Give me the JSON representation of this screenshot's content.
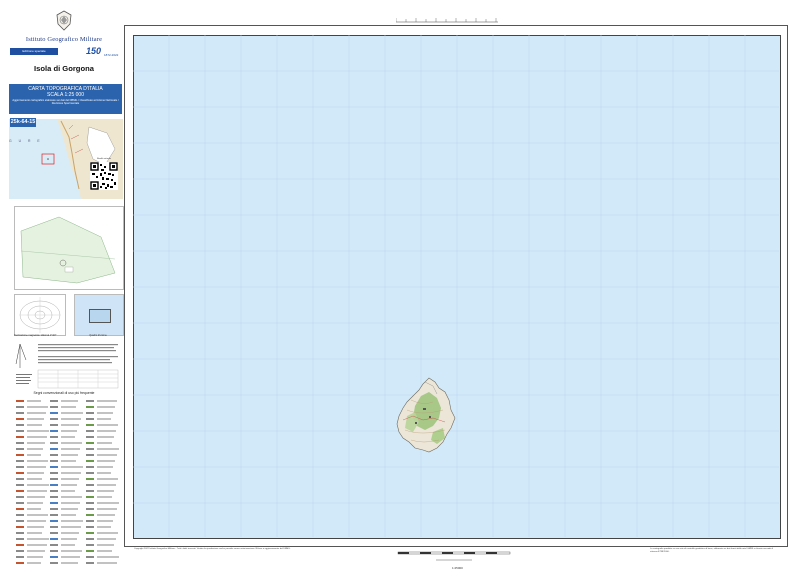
{
  "header": {
    "institute_name": "Istituto Geografico Militare",
    "edition_badge": "Edizione speciale",
    "logo_150": "150",
    "logo_150_sub": "1872-2022"
  },
  "sheet": {
    "name": "Isola di Gorgona",
    "code": "25k-64-15"
  },
  "series": {
    "title": "CARTA TOPOGRAFICA D'ITALIA",
    "scale": "SCALA 1:25 000",
    "notes": "Aggiornamento cartografico elaborato sui dati del DBMIL / Classificato ad Azione Nazionale / Revisione Sperimentale"
  },
  "location_map": {
    "sea_label": "G U R E",
    "qr_label": "Realtà virtuale"
  },
  "diagrams": {
    "magnetic_caption": "Declinazione magnetica: Valori al 1°/20°",
    "square_caption": "Quadro d'unione"
  },
  "legend": {
    "title": "Segni convenzionali di uso più frequente"
  },
  "footer": {
    "left_text": "Copyright 2022 Istituto Geografico Militare - Tutti i diritti riservati. Vietata la riproduzione anche parziale senza autorizzazione. Rilievo e aggiornamento del DBMIL.",
    "right_text": "La cartografia prodotta su una rete di controllo geodetica di base, elaborata sui dati forniti dalla rete IGM95 e rilevata secondo il sistema ETRF2000.",
    "page_number": "1:25000"
  },
  "colors": {
    "sea": "#d2e9f9",
    "brand_blue": "#2c63ad",
    "land": "#e8e2d2",
    "vegetation": "#8fb86a"
  }
}
